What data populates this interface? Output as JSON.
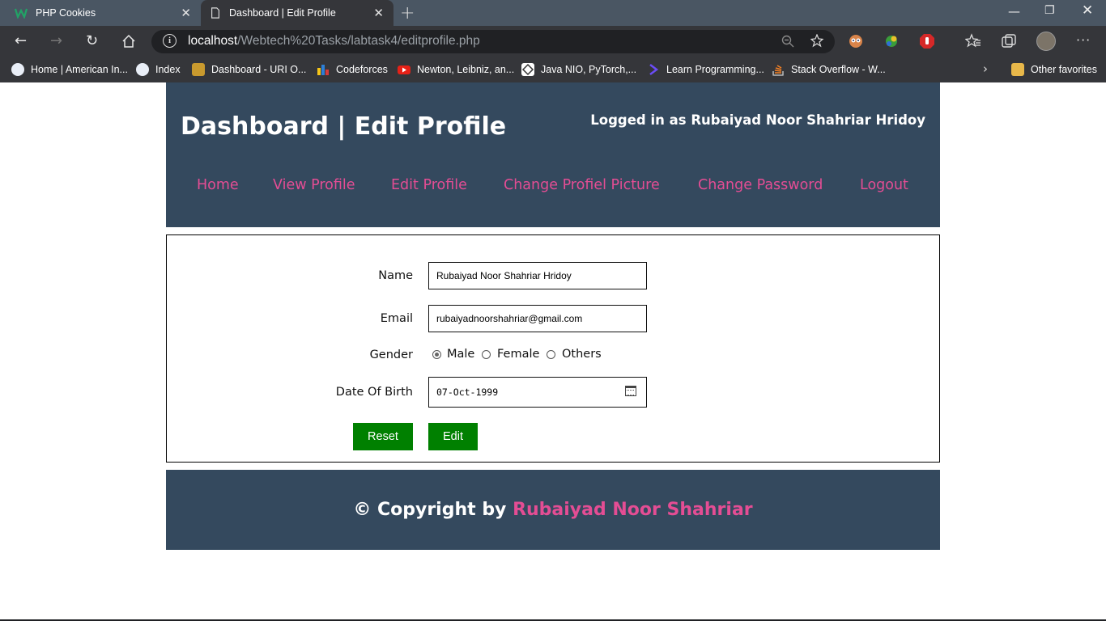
{
  "browser": {
    "tabs": [
      {
        "title": "PHP Cookies",
        "active": false,
        "icon": "w-favicon"
      },
      {
        "title": "Dashboard | Edit Profile",
        "active": true,
        "icon": "page-icon"
      }
    ],
    "address": {
      "host": "localhost",
      "path": "/Webtech%20Tasks/labtask4/editprofile.php"
    },
    "bookmarks": [
      {
        "label": "Home | American In...",
        "icon": "shield-icon"
      },
      {
        "label": "Index",
        "icon": "shield-icon"
      },
      {
        "label": "Dashboard - URI O...",
        "icon": "trophy-icon"
      },
      {
        "label": "Codeforces",
        "icon": "bars-icon"
      },
      {
        "label": "Newton, Leibniz, an...",
        "icon": "youtube-icon"
      },
      {
        "label": "Java NIO, PyTorch,...",
        "icon": "grid-icon"
      },
      {
        "label": "Learn Programming...",
        "icon": "code-icon"
      },
      {
        "label": "Stack Overflow - W...",
        "icon": "stack-icon"
      }
    ],
    "other_favorites": "Other favorites"
  },
  "header": {
    "title": "Dashboard | Edit Profile",
    "logged_in": "Logged in as Rubaiyad Noor Shahriar Hridoy",
    "nav": [
      "Home",
      "View Profile",
      "Edit Profile",
      "Change Profiel Picture",
      "Change Password",
      "Logout"
    ]
  },
  "form": {
    "name_label": "Name",
    "name_value": "Rubaiyad Noor Shahriar Hridoy",
    "email_label": "Email",
    "email_value": "rubaiyadnoorshahriar@gmail.com",
    "gender_label": "Gender",
    "gender_options": [
      "Male",
      "Female",
      "Others"
    ],
    "gender_selected": "Male",
    "dob_label": "Date Of Birth",
    "dob_value": "07-Oct-1999",
    "reset_label": "Reset",
    "edit_label": "Edit"
  },
  "footer": {
    "prefix": "© Copyright by ",
    "author": "Rubaiyad Noor Shahriar"
  },
  "colors": {
    "header_bg": "#34495e",
    "nav_link": "#e44d94",
    "button_bg": "#008000"
  }
}
